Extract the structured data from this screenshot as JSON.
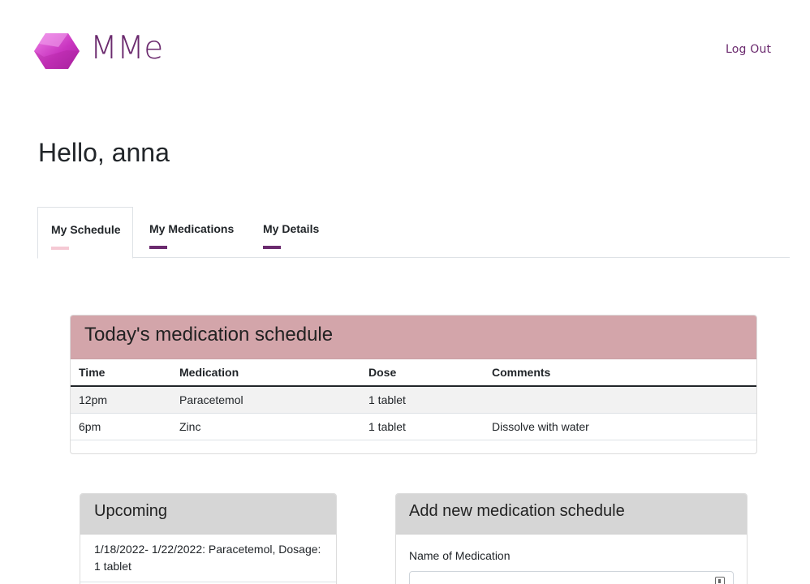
{
  "header": {
    "brand": "MMe",
    "logout_label": "Log Out",
    "colors": {
      "brand": "#6b2a6e",
      "logo_gradient_start": "#e35fd9",
      "logo_gradient_end": "#b72ab0"
    }
  },
  "greeting": "Hello, anna",
  "tabs": [
    {
      "label": "My Schedule",
      "active": true
    },
    {
      "label": "My Medications",
      "active": false
    },
    {
      "label": "My Details",
      "active": false
    }
  ],
  "today": {
    "title": "Today's medication schedule",
    "columns": [
      "Time",
      "Medication",
      "Dose",
      "Comments"
    ],
    "rows": [
      {
        "time": "12pm",
        "medication": "Paracetemol",
        "dose": "1 tablet",
        "comments": ""
      },
      {
        "time": "6pm",
        "medication": "Zinc",
        "dose": "1 tablet",
        "comments": "Dissolve with water"
      }
    ]
  },
  "upcoming": {
    "title": "Upcoming",
    "items": [
      "1/18/2022- 1/22/2022: Paracetemol, Dosage: 1 tablet"
    ]
  },
  "add_schedule": {
    "title": "Add new medication schedule",
    "name_label": "Name of Medication",
    "name_value": ""
  }
}
